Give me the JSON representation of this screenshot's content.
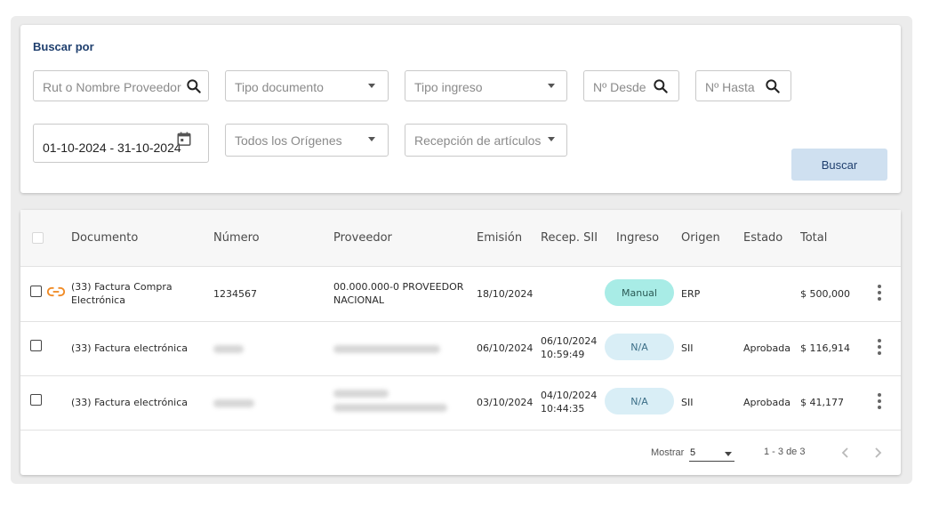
{
  "search": {
    "title": "Buscar por",
    "rut_placeholder": "Rut o Nombre Proveedor",
    "tipo_documento_placeholder": "Tipo documento",
    "tipo_ingreso_placeholder": "Tipo ingreso",
    "desde_placeholder": "Nº Desde",
    "hasta_placeholder": "Nº Hasta",
    "date_range": "01-10-2024 - 31-10-2024",
    "origenes_placeholder": "Todos los Orígenes",
    "recepcion_placeholder": "Recepción de artículos",
    "button_label": "Buscar"
  },
  "table": {
    "headers": {
      "documento": "Documento",
      "numero": "Número",
      "proveedor": "Proveedor",
      "emision": "Emisión",
      "recep_sii": "Recep. SII",
      "ingreso": "Ingreso",
      "origen": "Origen",
      "estado": "Estado",
      "total": "Total"
    },
    "rows": [
      {
        "documento_line1": "(33) Factura Compra",
        "documento_line2": "Electrónica",
        "numero": "1234567",
        "proveedor_line1": "00.000.000-0 PROVEEDOR",
        "proveedor_line2": "NACIONAL",
        "emision": "18/10/2024",
        "recep_date": "",
        "recep_time": "",
        "ingreso": "Manual",
        "origen": "ERP",
        "estado": "",
        "total": "$ 500,000"
      },
      {
        "documento_line1": "(33) Factura electrónica",
        "emision": "06/10/2024",
        "recep_date": "06/10/2024",
        "recep_time": "10:59:49",
        "ingreso": "N/A",
        "origen": "SII",
        "estado": "Aprobada",
        "total": "$ 116,914"
      },
      {
        "documento_line1": "(33) Factura electrónica",
        "emision": "03/10/2024",
        "recep_date": "04/10/2024",
        "recep_time": "10:44:35",
        "ingreso": "N/A",
        "origen": "SII",
        "estado": "Aprobada",
        "total": "$ 41,177"
      }
    ]
  },
  "pagination": {
    "show_label": "Mostrar",
    "page_size": "5",
    "range": "1 - 3 de 3"
  },
  "colors": {
    "title": "#1f3f6e",
    "button_bg": "#cfe0f0",
    "pill_manual": "#a8ece6",
    "pill_na": "#d9eef6",
    "link_icon": "#f08a24"
  }
}
